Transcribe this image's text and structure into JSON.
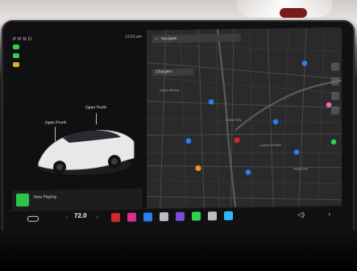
{
  "status": {
    "left": "P R N D",
    "right": "12:03 am"
  },
  "car": {
    "frunk_label": "Open Frunk",
    "trunk_label": "Open Trunk"
  },
  "media": {
    "title": "Now Playing",
    "subtitle": ""
  },
  "map": {
    "search_placeholder": "Navigate",
    "chip_label": "Chargers",
    "labels": [
      "Santa Monica",
      "Culver City",
      "Ladera Heights",
      "Inglewood"
    ]
  },
  "dock": {
    "temperature": "72.0",
    "volume_icon": "volume-icon"
  },
  "colors": {
    "accent_green": "#2fd34b",
    "map_blue": "#2f7df2",
    "map_red": "#d22929",
    "map_orange": "#f08f2a"
  }
}
